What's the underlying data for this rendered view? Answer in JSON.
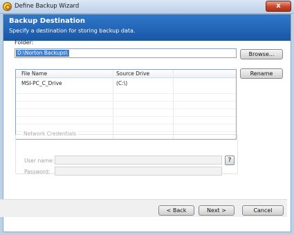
{
  "window": {
    "title": "Define Backup Wizard",
    "close_glyph": "x"
  },
  "header": {
    "title": "Backup Destination",
    "subtitle": "Specify a destination for storing backup data."
  },
  "folder": {
    "label": "Folder:",
    "value": "D:\\Norton Backups\\",
    "browse_label": "Browse..."
  },
  "list": {
    "columns": [
      "File Name",
      "Source Drive"
    ],
    "rows": [
      {
        "file_name": "MSI-PC_C_Drive",
        "source_drive": "(C:\\)"
      }
    ],
    "rename_label": "Rename"
  },
  "credentials": {
    "legend": "Network Credentials",
    "username_label": "User name:",
    "password_label": "Password:",
    "help_glyph": "?"
  },
  "footer": {
    "back_label": "< Back",
    "next_label": "Next >",
    "cancel_label": "Cancel"
  }
}
